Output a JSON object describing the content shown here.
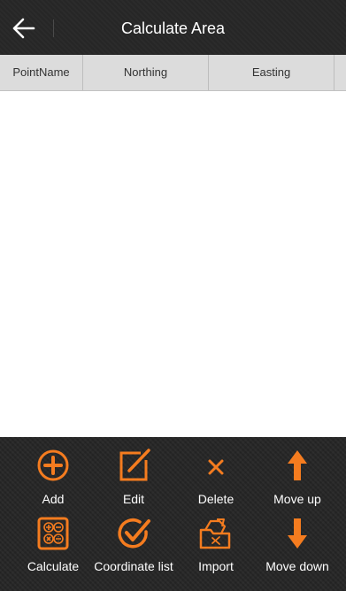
{
  "header": {
    "title": "Calculate Area",
    "back_icon": "arrow-left-icon"
  },
  "table": {
    "columns": [
      "PointName",
      "Northing",
      "Easting",
      ""
    ],
    "rows": []
  },
  "toolbar": {
    "items": [
      {
        "label": "Add",
        "icon": "plus-circle-icon"
      },
      {
        "label": "Edit",
        "icon": "edit-square-icon"
      },
      {
        "label": "Delete",
        "icon": "close-x-icon"
      },
      {
        "label": "Move up",
        "icon": "arrow-up-icon"
      },
      {
        "label": "Calculate",
        "icon": "calculator-icon"
      },
      {
        "label": "Coordinate list",
        "icon": "check-circle-icon"
      },
      {
        "label": "Import",
        "icon": "import-folder-icon"
      },
      {
        "label": "Move down",
        "icon": "arrow-down-icon"
      }
    ]
  },
  "colors": {
    "accent": "#f57c1f",
    "titlebar": "#262626",
    "toolbar": "#232323",
    "header_bg": "#dcdcdc"
  }
}
